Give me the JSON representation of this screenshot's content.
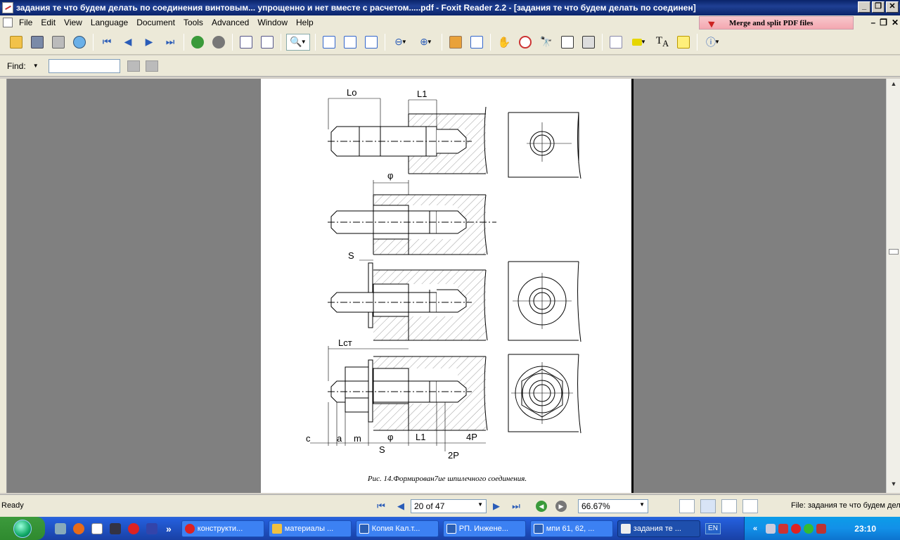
{
  "window": {
    "title": "задания те что будем делать по соединения винтовым... упрощенно и нет  вместе с расчетом.....pdf - Foxit Reader 2.2 - [задания те что будем делать по соединен]",
    "buttons": [
      "_",
      "❐",
      "✕"
    ]
  },
  "menu": {
    "items": [
      "File",
      "Edit",
      "View",
      "Language",
      "Document",
      "Tools",
      "Advanced",
      "Window",
      "Help"
    ],
    "promo": "Merge and split PDF files"
  },
  "find": {
    "label": "Find:",
    "value": ""
  },
  "drawing": {
    "labels": {
      "lo": "Lo",
      "l1_top": "L1",
      "phi_top": "φ",
      "s_mid": "S",
      "lct": "Lст",
      "c": "c",
      "a": "a",
      "m": "m",
      "s_bot": "S",
      "phi_bot": "φ",
      "l1_bot": "L1",
      "p4": "4P",
      "p2": "2P"
    },
    "caption": "Рис. 14.Формирован7ие шпилечного соединения."
  },
  "status": {
    "ready": "Ready",
    "page_field": "20 of 47",
    "zoom": "66.67%",
    "file_info": "File: задания те что будем дел"
  },
  "taskbar": {
    "tasks": [
      {
        "label": "конструкти...",
        "color": "#d22"
      },
      {
        "label": "материалы ...",
        "color": "#f0c040"
      },
      {
        "label": "Копия Кал.т...",
        "color": "#2b5fb3"
      },
      {
        "label": "РП. Инжене...",
        "color": "#2b5fb3"
      },
      {
        "label": "мпи 61, 62, ...",
        "color": "#2b5fb3"
      },
      {
        "label": "задания те ...",
        "color": "#eee"
      }
    ],
    "lang": "EN",
    "clock": "23:10"
  }
}
